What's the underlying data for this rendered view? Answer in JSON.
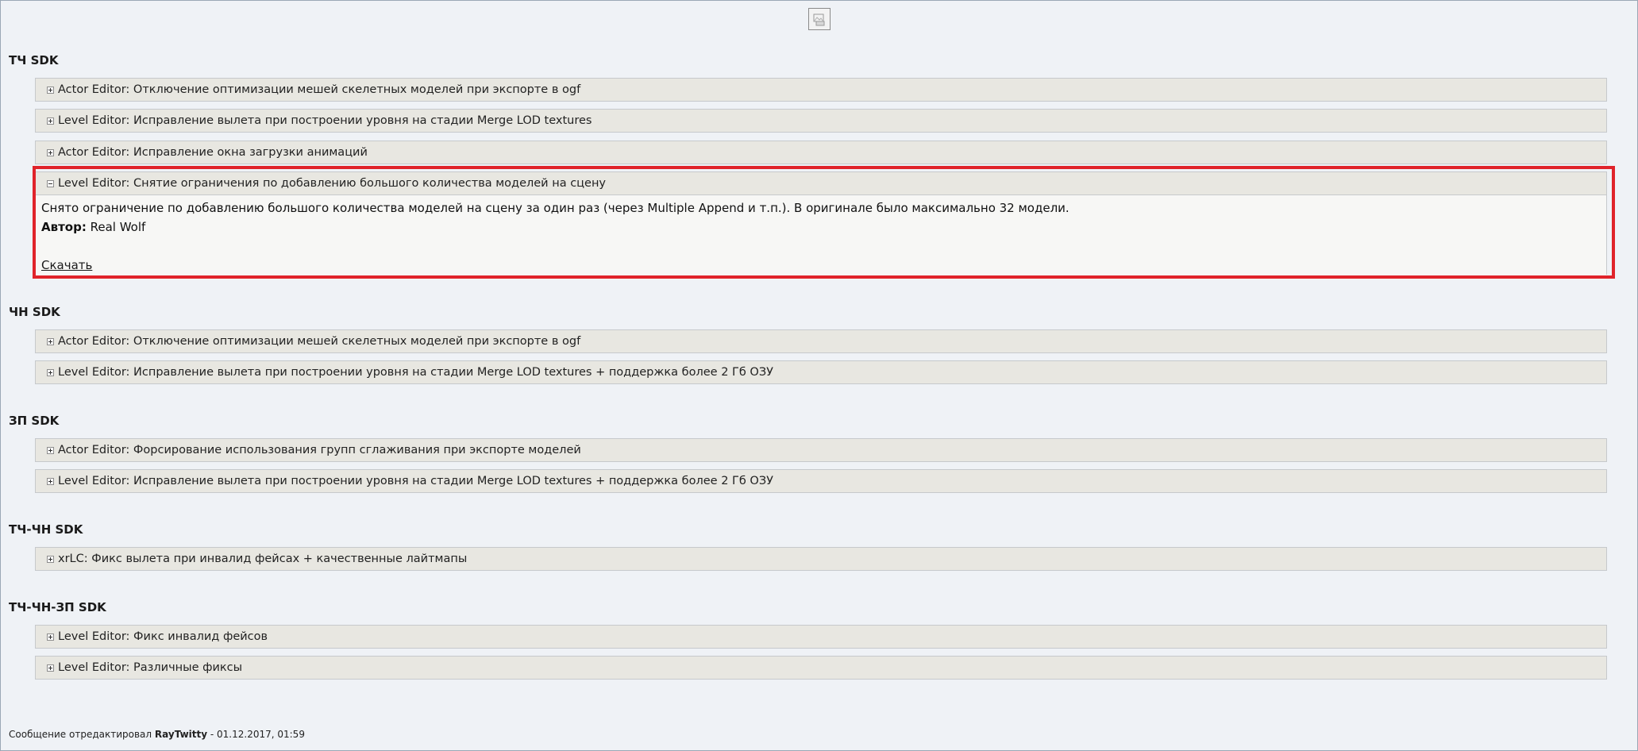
{
  "sections": [
    {
      "title": "ТЧ SDK",
      "spoilers": [
        {
          "title": "Actor Editor: Отключение оптимизации мешей скелетных моделей при экспорте в ogf"
        },
        {
          "title": "Level Editor: Исправление вылета при построении уровня на стадии Merge LOD textures"
        },
        {
          "title": "Actor Editor: Исправление окна загрузки анимаций"
        },
        {
          "title": "Level Editor: Снятие ограничения по добавлению большого количества моделей на сцену",
          "expanded": true,
          "body": {
            "text": "Снято ограничение по добавлению большого количества моделей на сцену за один раз (через Multiple Append и т.п.). В оригинале было максимально 32 модели.",
            "author_label": "Автор:",
            "author": "Real Wolf",
            "download_label": "Скачать"
          }
        }
      ]
    },
    {
      "title": "ЧН SDK",
      "spoilers": [
        {
          "title": "Actor Editor: Отключение оптимизации мешей скелетных моделей при экспорте в ogf"
        },
        {
          "title": "Level Editor: Исправление вылета при построении уровня на стадии Merge LOD textures + поддержка более 2 Гб ОЗУ"
        }
      ]
    },
    {
      "title": "ЗП SDK",
      "spoilers": [
        {
          "title": "Actor Editor: Форсирование использования групп сглаживания при экспорте моделей"
        },
        {
          "title": "Level Editor: Исправление вылета при построении уровня на стадии Merge LOD textures + поддержка более 2 Гб ОЗУ"
        }
      ]
    },
    {
      "title": "ТЧ-ЧН SDK",
      "spoilers": [
        {
          "title": "xrLC: Фикс вылета при инвалид фейсах + качественные лайтмапы"
        }
      ]
    },
    {
      "title": "ТЧ-ЧН-ЗП SDK",
      "spoilers": [
        {
          "title": "Level Editor: Фикс инвалид фейсов"
        },
        {
          "title": "Level Editor: Различные фиксы"
        }
      ]
    }
  ],
  "footer": {
    "prefix": "Сообщение отредактировал",
    "user": "RayTwitty",
    "suffix": "- 01.12.2017, 01:59"
  },
  "colors": {
    "highlight": "#e0232a",
    "spoiler_header": "#e8e7e1",
    "page_background": "#eff2f6"
  },
  "icons": {
    "placeholder": "broken-image-icon",
    "collapsed": "plus-box-icon",
    "expanded": "minus-box-icon"
  }
}
